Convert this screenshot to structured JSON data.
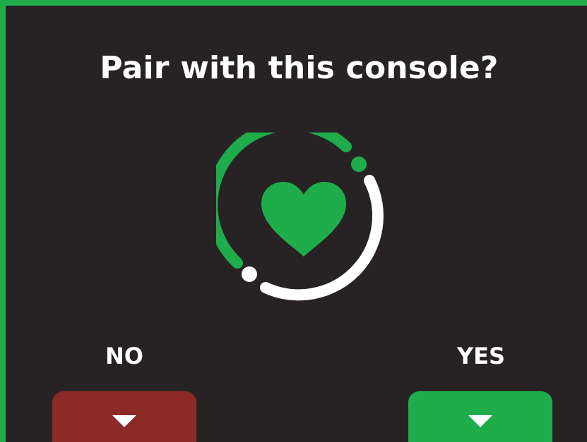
{
  "dialog": {
    "title": "Pair with this console?",
    "icon": "heart-icon",
    "accent_color": "#1fad4b"
  },
  "choices": {
    "no_label": "NO",
    "yes_label": "YES",
    "no_color": "#8c2a28",
    "yes_color": "#1fad4b"
  }
}
